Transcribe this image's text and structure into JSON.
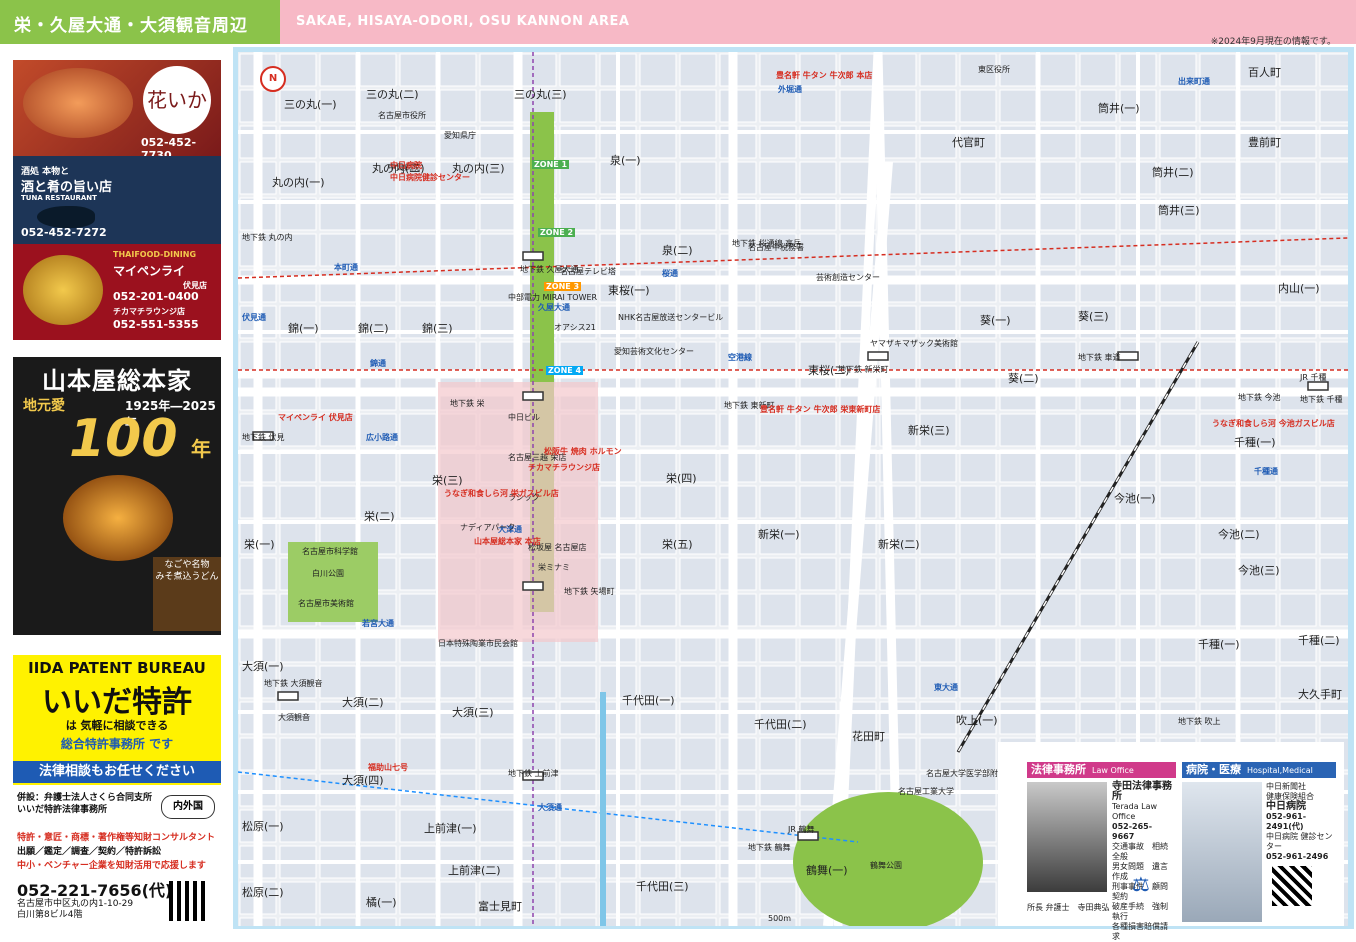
{
  "header": {
    "title_ja": "栄・久屋大通・大須観音周辺",
    "title_en": "SAKAE, HISAYA-ODORI, OSU KANNON AREA",
    "note": "※2024年9月現在の情報です。",
    "colors": {
      "green": "#8bc34a",
      "pink": "#f7b9c6"
    }
  },
  "ads": {
    "restaurant": {
      "logo": "花いかだ",
      "phone1": "052-452-7730",
      "tagline": "酒と肴の旨い店",
      "sub": "酒処 本物と",
      "en": "TUNA RESTAURANT",
      "phone2": "052-452-7272",
      "thai_label": "THAIFOOD-DINING",
      "thai_name": "マイペンライ",
      "thai_branch1": "伏見店",
      "thai_phone1": "052-201-0400",
      "thai_branch2": "チカマチラウンジ店",
      "thai_phone2": "052-551-5355"
    },
    "yamamotoya": {
      "title": "山本屋総本家",
      "local": "地元愛",
      "years": "1925年―2025年",
      "hundred": "100",
      "year_suffix": "年",
      "caption1": "なごや名物",
      "caption2": "みそ煮込うどん"
    },
    "patent": {
      "name_en": "IIDA PATENT BUREAU",
      "name_ja": "いいだ特許",
      "sub1": "は 気軽に相談できる",
      "sub2": "総合特許事務所 です",
      "band": "法律相談もお任せください",
      "line1": "併設：弁護士法人さくら合同支所",
      "line2": "いいだ特許法律事務所",
      "badge": "内外国",
      "line3": "特許・意匠・商標・著作権等知財コンサルタント",
      "line4": "出願／鑑定／調査／契約／特許訴訟",
      "line5": "中小・ベンチャー企業を知財活用で応援します",
      "phone": "052-221-7656(代)",
      "addr1": "名古屋市中区丸の内1-10-29",
      "addr2": "白川第8ビル4階"
    }
  },
  "map": {
    "north_label": "N",
    "scale_label": "500m",
    "areas": [
      {
        "ja": "三の丸(一)",
        "en": "Sannomaru 1"
      },
      {
        "ja": "三の丸(二)",
        "en": "Sannomaru 2"
      },
      {
        "ja": "三の丸(三)",
        "en": "Sannomaru 3"
      },
      {
        "ja": "丸の内(一)",
        "en": "Marunouchi 1"
      },
      {
        "ja": "丸の内(二)",
        "en": "Marunouchi 2"
      },
      {
        "ja": "丸の内(三)",
        "en": "Marunouchi 3"
      },
      {
        "ja": "錦(一)",
        "en": "Nishiki 1"
      },
      {
        "ja": "錦(二)",
        "en": "Nishiki 2"
      },
      {
        "ja": "錦(三)",
        "en": "Nishiki 3"
      },
      {
        "ja": "栄(一)",
        "en": "Sakae 1"
      },
      {
        "ja": "栄(二)",
        "en": "Sakae 2"
      },
      {
        "ja": "栄(三)",
        "en": "Sakae 3"
      },
      {
        "ja": "栄(四)",
        "en": "Sakae 4"
      },
      {
        "ja": "栄(五)",
        "en": "Sakae 5"
      },
      {
        "ja": "泉(一)",
        "en": "Izumi 1"
      },
      {
        "ja": "泉(二)",
        "en": "Izumi 2"
      },
      {
        "ja": "東桜(一)",
        "en": "Higashisakura 1"
      },
      {
        "ja": "東桜(二)",
        "en": "Higashisakura 2"
      },
      {
        "ja": "新栄(一)",
        "en": "Shinsakae 1"
      },
      {
        "ja": "新栄(二)",
        "en": "Shinsakae 2"
      },
      {
        "ja": "新栄(三)",
        "en": "Shinsakae 3"
      },
      {
        "ja": "葵(一)",
        "en": "Aoi 1"
      },
      {
        "ja": "葵(二)",
        "en": "Aoi 2"
      },
      {
        "ja": "葵(三)",
        "en": "Aoi 3"
      },
      {
        "ja": "筒井(一)",
        "en": "Tsutsui 1"
      },
      {
        "ja": "筒井(二)",
        "en": "Tsutsui 2"
      },
      {
        "ja": "筒井(三)",
        "en": "Tsutsui 3"
      },
      {
        "ja": "代官町",
        "en": "Daikancho"
      },
      {
        "ja": "百人町",
        "en": "Hyakunincho"
      },
      {
        "ja": "豊前町",
        "en": "Buzencho"
      },
      {
        "ja": "内山(一)",
        "en": "Uchiyama 1"
      },
      {
        "ja": "千種(一)",
        "en": "Chikusa 1"
      },
      {
        "ja": "今池(一)",
        "en": "Imaike 1"
      },
      {
        "ja": "今池(二)",
        "en": "Imaike 2"
      },
      {
        "ja": "今池(三)",
        "en": "Imaike 3"
      },
      {
        "ja": "大須(一)",
        "en": "Osu 1"
      },
      {
        "ja": "大須(二)",
        "en": "Osu 2"
      },
      {
        "ja": "大須(三)",
        "en": "Osu 3"
      },
      {
        "ja": "大須(四)",
        "en": "Osu 4"
      },
      {
        "ja": "上前津(一)",
        "en": "Kamimaezu 1"
      },
      {
        "ja": "上前津(二)",
        "en": "Kamimaezu 2"
      },
      {
        "ja": "千代田(一)",
        "en": "Chiyoda 1"
      },
      {
        "ja": "千代田(二)",
        "en": "Chiyoda 2"
      },
      {
        "ja": "千代田(三)",
        "en": "Chiyoda 3"
      },
      {
        "ja": "松原(一)",
        "en": "Matsubara 1"
      },
      {
        "ja": "松原(二)",
        "en": "Matsubara 2"
      },
      {
        "ja": "橘(一)",
        "en": "Tachibana 1"
      },
      {
        "ja": "富士見町",
        "en": "Fujimicho"
      },
      {
        "ja": "鶴舞(一)",
        "en": "Tsurumai 1"
      },
      {
        "ja": "吹上(一)",
        "en": "Fukiage 1"
      },
      {
        "ja": "花田町",
        "en": "Hanadacho"
      },
      {
        "ja": "大久手町",
        "en": "Okutecho"
      },
      {
        "ja": "千種(一)",
        "en": "Chikusa 1"
      },
      {
        "ja": "千種(二)",
        "en": "Chikusa 2"
      }
    ],
    "stations": [
      "地下鉄 丸の内",
      "地下鉄 桜通線 高岳",
      "地下鉄 久屋大通",
      "地下鉄 栄",
      "地下鉄 伏見",
      "地下鉄 矢場町",
      "地下鉄 上前津",
      "地下鉄 大須観音",
      "地下鉄 新栄町",
      "地下鉄 東新町",
      "地下鉄 車道",
      "地下鉄 今池",
      "地下鉄 鶴舞",
      "JR 鶴舞",
      "JR 千種",
      "地下鉄 千種",
      "地下鉄 吹上",
      "地下鉄 栄・名城線 矢場町"
    ],
    "streets": [
      "桜通",
      "錦通",
      "広小路通",
      "若宮大通",
      "大津通",
      "伏見通",
      "本町通",
      "久屋大通",
      "空港線",
      "出来町通",
      "外堀通",
      "東大通",
      "大須通",
      "千種通"
    ],
    "pois": [
      "名古屋市役所",
      "愛知県庁",
      "名古屋テレビ塔",
      "中部電力 MIRAI TOWER",
      "オアシス21",
      "愛知芸術文化センター",
      "NHK名古屋放送センタービル",
      "名古屋市科学館",
      "名古屋市美術館",
      "白川公園",
      "大須観音",
      "鶴舞公園",
      "名古屋大学医学部附属病院",
      "中日病院",
      "中日ビル",
      "名古屋三越 栄店",
      "松坂屋 名古屋店",
      "ナディアパーク",
      "ラシック",
      "栄ミナミ",
      "日本特殊陶業市民会館",
      "名古屋工業大学",
      "東区役所",
      "名古屋中税務署",
      "芸術創造センター",
      "ヤマザキマザック美術館"
    ],
    "red_pois": [
      "豊名軒 牛タン 牛次郎 本店",
      "豊名軒 牛タン 牛次郎 栄東新町店",
      "マイペンライ 伏見店",
      "うなぎ和食しら河 栄ガスビル店",
      "うなぎ和食しら河 今池ガスビル店",
      "松阪牛 焼肉 ホルモン",
      "チカマチラウンジ店",
      "中日病院",
      "中日病院健診センター",
      "山本屋総本家 本店",
      "福助山七号"
    ],
    "zones": [
      "ZONE 1",
      "ZONE 2",
      "ZONE 3",
      "ZONE 4"
    ]
  },
  "info": {
    "law": {
      "tab": "法律事務所",
      "tab_en": "Law Office",
      "name": "寺田法律事務所",
      "name_en": "Terada Law Office",
      "phone": "052-265-9667",
      "services1": "交通事故　相続全般",
      "services2": "男女問題　遺言作成",
      "services3": "刑事事件　顧問契約",
      "services4": "破産手続　強制執行",
      "services5": "各種損害賠償請求",
      "caption": "所長 弁護士　寺田典弘"
    },
    "medical": {
      "tab": "病院・医療",
      "tab_en": "Hospital,Medical",
      "org1": "中日新聞社",
      "org2": "健康保険組合",
      "name": "中日病院",
      "phone1": "052-961-2491(代)",
      "center": "中日病院 健診センター",
      "phone2": "052-961-2496"
    }
  }
}
